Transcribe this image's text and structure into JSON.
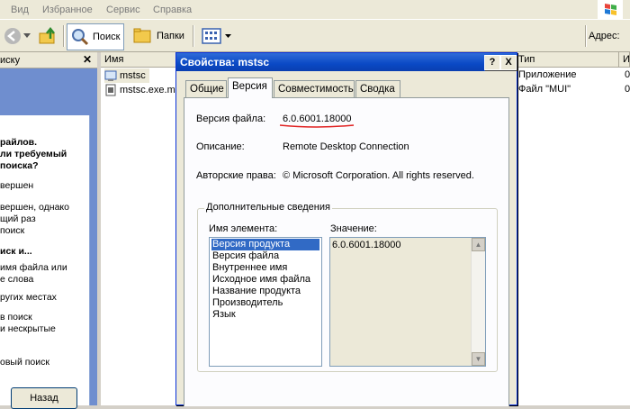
{
  "menu": [
    "Вид",
    "Избранное",
    "Сервис",
    "Справка"
  ],
  "toolbar": {
    "search": "Поиск",
    "folders": "Папки",
    "address_label": "Адрес:"
  },
  "left_panel": {
    "header": "иску",
    "lines": [
      "райлов.",
      "ли требуемый",
      "поиска?",
      "вершен",
      "вершен, однако",
      "щий раз",
      "поиск",
      "иск и...",
      "имя файла или",
      "е слова",
      "ругих местах",
      "в поиск",
      "и нескрытые",
      "овый поиск"
    ],
    "back_button": "Назад"
  },
  "file_list": {
    "columns": [
      "Имя",
      "Тип",
      "И"
    ],
    "rows": [
      {
        "name": "mstsc",
        "type": "Приложение",
        "extra": "0"
      },
      {
        "name": "mstsc.exe.m",
        "type": "Файл \"MUI\"",
        "extra": "0"
      }
    ]
  },
  "dialog": {
    "title": "Свойства: mstsc",
    "help_btn": "?",
    "close_btn": "X",
    "tabs": [
      "Общие",
      "Версия",
      "Совместимость",
      "Сводка"
    ],
    "file_version_label": "Версия файла:",
    "file_version_value": "6.0.6001.18000",
    "description_label": "Описание:",
    "description_value": "Remote Desktop Connection",
    "copyright_label": "Авторские права:",
    "copyright_value": "© Microsoft Corporation. All rights reserved.",
    "group_title": "Дополнительные сведения",
    "item_name_label": "Имя элемента:",
    "value_label": "Значение:",
    "items": [
      "Версия продукта",
      "Версия файла",
      "Внутреннее имя",
      "Исходное имя файла",
      "Название продукта",
      "Производитель",
      "Язык"
    ],
    "selected_value": "6.0.6001.18000"
  },
  "colors": {
    "titlebar": "#0a49c5",
    "selection": "#316ac5",
    "annotation_underline": "#e02020"
  }
}
